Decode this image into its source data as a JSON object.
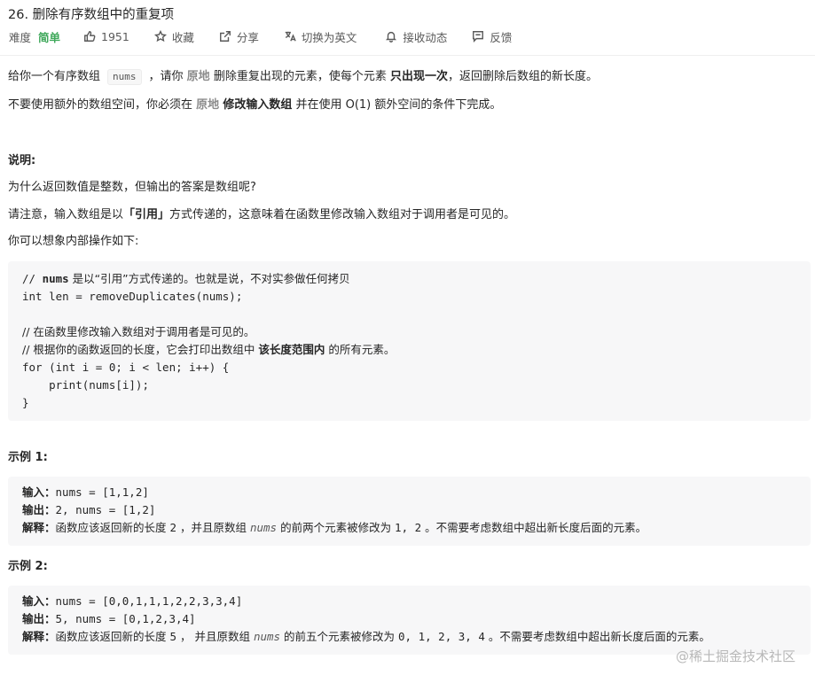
{
  "problem": {
    "title": "26. 删除有序数组中的重复项",
    "difficulty_label": "难度",
    "difficulty": "简单",
    "likes": "1951",
    "favorite": "收藏",
    "share": "分享",
    "switch_lang": "切换为英文",
    "subscribe": "接收动态",
    "feedback": "反馈"
  },
  "desc": {
    "p1_a": "给你一个有序数组",
    "p1_code": "nums",
    "p1_b": "，请你",
    "p1_c": "原地",
    "p1_d": "删除重复出现的元素，使每个元素",
    "p1_e": "只出现一次",
    "p1_f": "，返回删除后数组的新长度。",
    "p2_a": "不要使用额外的数组空间，你必须在",
    "p2_b": "原地",
    "p2_c": "修改输入数组",
    "p2_d": "并在使用 O(1) 额外空间的条件下完成。",
    "note_heading": "说明:",
    "note_1": "为什么返回数值是整数，但输出的答案是数组呢?",
    "note_2a": "请注意，输入数组是以",
    "note_2b": "「引用」",
    "note_2c": "方式传递的，这意味着在函数里修改输入数组对于调用者是可见的。",
    "note_3": "你可以想象内部操作如下:"
  },
  "code": {
    "l1a": "// ",
    "l1b": "nums",
    "l1c": " 是以“引用”方式传递的。也就是说，不对实参做任何拷贝",
    "l2": "int len = removeDuplicates(nums);",
    "l3": "// 在函数里修改输入数组对于调用者是可见的。",
    "l4a": "// 根据你的函数返回的长度，它会打印出数组中 ",
    "l4b": "该长度范围内",
    "l4c": " 的所有元素。",
    "l5": "for (int i = 0; i < len; i++) {",
    "l6": "    print(nums[i]);",
    "l7": "}"
  },
  "ex1": {
    "heading": "示例 1:",
    "in_label": "输入：",
    "in_val": "nums = [1,1,2]",
    "out_label": "输出：",
    "out_val": "2, nums = [1,2]",
    "exp_label": "解释：",
    "exp_a": "函数应该返回新的长度 ",
    "exp_b": "2",
    "exp_c": " ，并且原数组 ",
    "exp_d": "nums",
    "exp_e": " 的前两个元素被修改为 ",
    "exp_f": "1, 2",
    "exp_g": " 。不需要考虑数组中超出新长度后面的元素。"
  },
  "ex2": {
    "heading": "示例 2:",
    "in_label": "输入：",
    "in_val": "nums = [0,0,1,1,1,2,2,3,3,4]",
    "out_label": "输出：",
    "out_val": "5, nums = [0,1,2,3,4]",
    "exp_label": "解释：",
    "exp_a": "函数应该返回新的长度 ",
    "exp_b": "5",
    "exp_c": " ， 并且原数组 ",
    "exp_d": "nums",
    "exp_e": " 的前五个元素被修改为 ",
    "exp_f": "0, 1, 2, 3, 4",
    "exp_g": " 。不需要考虑数组中超出新长度后面的元素。"
  },
  "watermark": "@稀土掘金技术社区"
}
